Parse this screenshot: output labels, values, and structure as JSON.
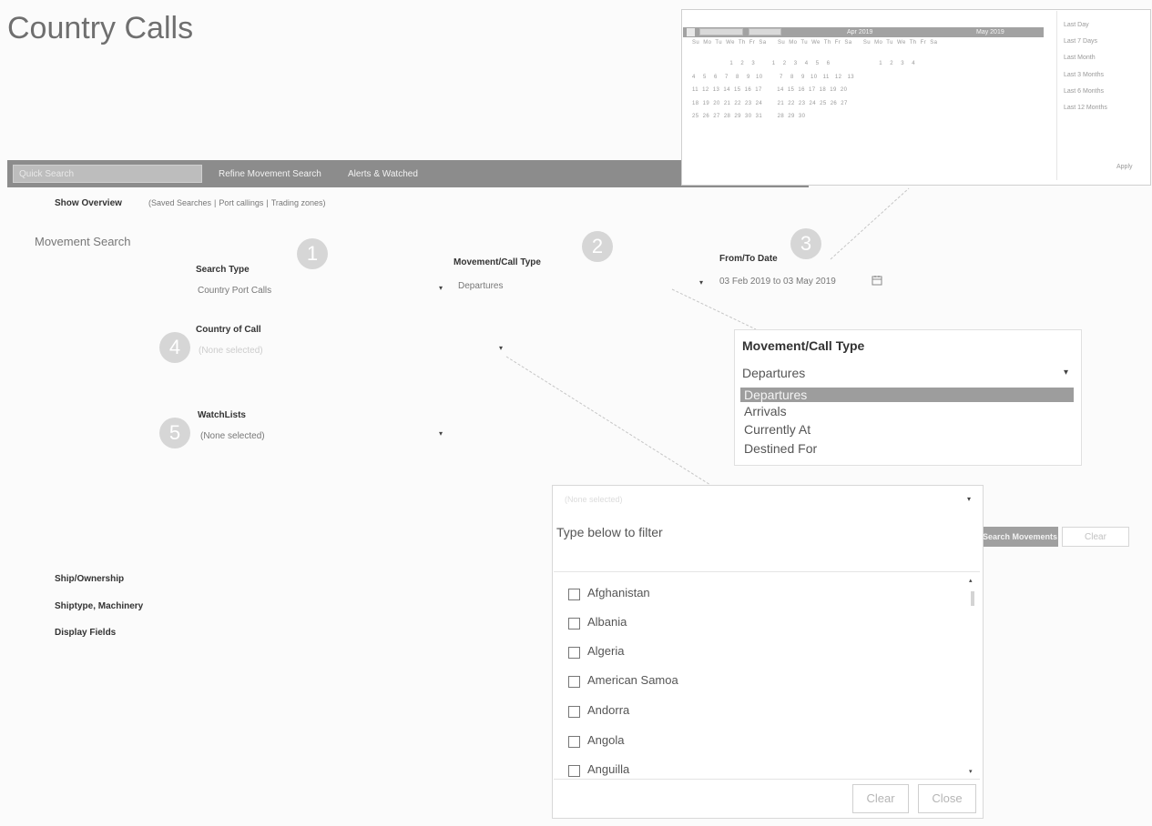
{
  "page_title": "Country Calls",
  "toolbar": {
    "quick_search_placeholder": "Quick Search",
    "links": [
      "Refine Movement Search",
      "Alerts & Watched"
    ]
  },
  "overview": {
    "label": "Show Overview",
    "links": [
      "(Saved Searches",
      "Port callings",
      "Trading zones)"
    ]
  },
  "section_title": "Movement Search",
  "steps": [
    "1",
    "2",
    "3",
    "4",
    "5"
  ],
  "fields": {
    "search_type": {
      "label": "Search Type",
      "value": "Country Port Calls"
    },
    "movement_call_type": {
      "label": "Movement/Call Type",
      "value": "Departures"
    },
    "from_to_date": {
      "label": "From/To Date",
      "value": "03 Feb 2019 to 03 May 2019"
    },
    "country_of_call": {
      "label": "Country of Call",
      "value": "(None selected)"
    },
    "watchlists": {
      "label": "WatchLists",
      "value": "(None selected)"
    }
  },
  "calendar": {
    "left_month": "Apr 2019",
    "right_month": "May 2019",
    "weekday_row": "Su  Mo  Tu  We  Th  Fr  Sa      Su  Mo  Tu  We  Th  Fr  Sa      Su  Mo  Tu  We  Th  Fr  Sa",
    "rows": [
      "                    1    2    3         1    2    3    4    5    6                          1    2    3    4",
      "4    5    6    7    8    9   10         7    8    9   10   11   12   13",
      "11  12  13  14  15  16  17        14  15  16  17  18  19  20",
      "18  19  20  21  22  23  24        21  22  23  24  25  26  27",
      "25  26  27  28  29  30  31        28  29  30"
    ],
    "ranges": [
      "Last Day",
      "Last 7 Days",
      "Last Month",
      "Last 3 Months",
      "Last 6 Months",
      "Last 12 Months"
    ],
    "apply_label": "Apply"
  },
  "movement_call_type_popup": {
    "title": "Movement/Call Type",
    "selected": "Departures",
    "options": [
      "Departures",
      "Arrivals",
      "Currently At",
      "Destined For"
    ]
  },
  "country_panel": {
    "select_placeholder": "(None selected)",
    "filter_placeholder": "Type below to filter",
    "countries": [
      "Afghanistan",
      "Albania",
      "Algeria",
      "American Samoa",
      "Andorra",
      "Angola",
      "Anguilla"
    ],
    "clear_label": "Clear",
    "close_label": "Close"
  },
  "actions": {
    "search_label": "Search Movements",
    "clear_label": "Clear"
  },
  "side_links": [
    "Ship/Ownership",
    "Shiptype, Machinery",
    "Display Fields"
  ],
  "colors": {
    "toolbar": "#8c8c8c",
    "highlight": "#9d9d9d",
    "step_circle": "#d6d6d6"
  }
}
